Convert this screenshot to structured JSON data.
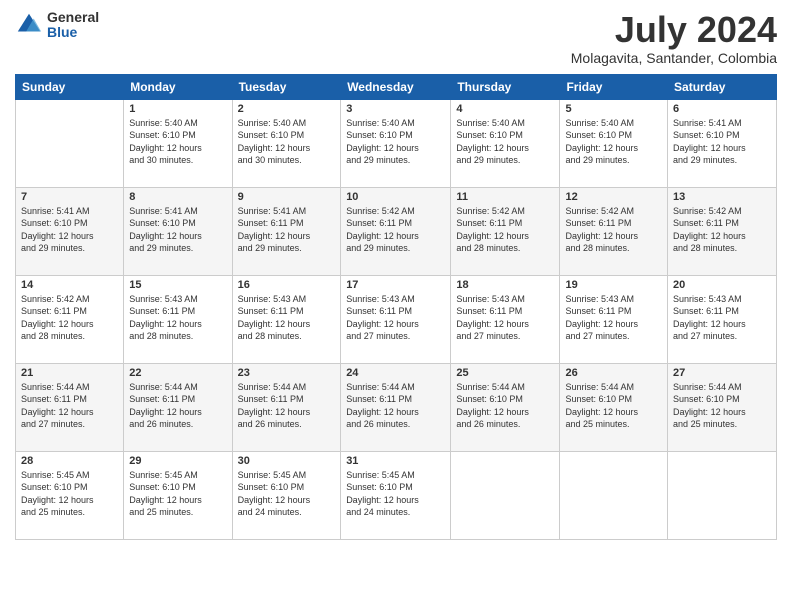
{
  "logo": {
    "general": "General",
    "blue": "Blue"
  },
  "title": "July 2024",
  "location": "Molagavita, Santander, Colombia",
  "days_header": [
    "Sunday",
    "Monday",
    "Tuesday",
    "Wednesday",
    "Thursday",
    "Friday",
    "Saturday"
  ],
  "weeks": [
    [
      {
        "num": "",
        "info": ""
      },
      {
        "num": "1",
        "info": "Sunrise: 5:40 AM\nSunset: 6:10 PM\nDaylight: 12 hours\nand 30 minutes."
      },
      {
        "num": "2",
        "info": "Sunrise: 5:40 AM\nSunset: 6:10 PM\nDaylight: 12 hours\nand 30 minutes."
      },
      {
        "num": "3",
        "info": "Sunrise: 5:40 AM\nSunset: 6:10 PM\nDaylight: 12 hours\nand 29 minutes."
      },
      {
        "num": "4",
        "info": "Sunrise: 5:40 AM\nSunset: 6:10 PM\nDaylight: 12 hours\nand 29 minutes."
      },
      {
        "num": "5",
        "info": "Sunrise: 5:40 AM\nSunset: 6:10 PM\nDaylight: 12 hours\nand 29 minutes."
      },
      {
        "num": "6",
        "info": "Sunrise: 5:41 AM\nSunset: 6:10 PM\nDaylight: 12 hours\nand 29 minutes."
      }
    ],
    [
      {
        "num": "7",
        "info": "Sunrise: 5:41 AM\nSunset: 6:10 PM\nDaylight: 12 hours\nand 29 minutes."
      },
      {
        "num": "8",
        "info": "Sunrise: 5:41 AM\nSunset: 6:10 PM\nDaylight: 12 hours\nand 29 minutes."
      },
      {
        "num": "9",
        "info": "Sunrise: 5:41 AM\nSunset: 6:11 PM\nDaylight: 12 hours\nand 29 minutes."
      },
      {
        "num": "10",
        "info": "Sunrise: 5:42 AM\nSunset: 6:11 PM\nDaylight: 12 hours\nand 29 minutes."
      },
      {
        "num": "11",
        "info": "Sunrise: 5:42 AM\nSunset: 6:11 PM\nDaylight: 12 hours\nand 28 minutes."
      },
      {
        "num": "12",
        "info": "Sunrise: 5:42 AM\nSunset: 6:11 PM\nDaylight: 12 hours\nand 28 minutes."
      },
      {
        "num": "13",
        "info": "Sunrise: 5:42 AM\nSunset: 6:11 PM\nDaylight: 12 hours\nand 28 minutes."
      }
    ],
    [
      {
        "num": "14",
        "info": "Sunrise: 5:42 AM\nSunset: 6:11 PM\nDaylight: 12 hours\nand 28 minutes."
      },
      {
        "num": "15",
        "info": "Sunrise: 5:43 AM\nSunset: 6:11 PM\nDaylight: 12 hours\nand 28 minutes."
      },
      {
        "num": "16",
        "info": "Sunrise: 5:43 AM\nSunset: 6:11 PM\nDaylight: 12 hours\nand 28 minutes."
      },
      {
        "num": "17",
        "info": "Sunrise: 5:43 AM\nSunset: 6:11 PM\nDaylight: 12 hours\nand 27 minutes."
      },
      {
        "num": "18",
        "info": "Sunrise: 5:43 AM\nSunset: 6:11 PM\nDaylight: 12 hours\nand 27 minutes."
      },
      {
        "num": "19",
        "info": "Sunrise: 5:43 AM\nSunset: 6:11 PM\nDaylight: 12 hours\nand 27 minutes."
      },
      {
        "num": "20",
        "info": "Sunrise: 5:43 AM\nSunset: 6:11 PM\nDaylight: 12 hours\nand 27 minutes."
      }
    ],
    [
      {
        "num": "21",
        "info": "Sunrise: 5:44 AM\nSunset: 6:11 PM\nDaylight: 12 hours\nand 27 minutes."
      },
      {
        "num": "22",
        "info": "Sunrise: 5:44 AM\nSunset: 6:11 PM\nDaylight: 12 hours\nand 26 minutes."
      },
      {
        "num": "23",
        "info": "Sunrise: 5:44 AM\nSunset: 6:11 PM\nDaylight: 12 hours\nand 26 minutes."
      },
      {
        "num": "24",
        "info": "Sunrise: 5:44 AM\nSunset: 6:11 PM\nDaylight: 12 hours\nand 26 minutes."
      },
      {
        "num": "25",
        "info": "Sunrise: 5:44 AM\nSunset: 6:10 PM\nDaylight: 12 hours\nand 26 minutes."
      },
      {
        "num": "26",
        "info": "Sunrise: 5:44 AM\nSunset: 6:10 PM\nDaylight: 12 hours\nand 25 minutes."
      },
      {
        "num": "27",
        "info": "Sunrise: 5:44 AM\nSunset: 6:10 PM\nDaylight: 12 hours\nand 25 minutes."
      }
    ],
    [
      {
        "num": "28",
        "info": "Sunrise: 5:45 AM\nSunset: 6:10 PM\nDaylight: 12 hours\nand 25 minutes."
      },
      {
        "num": "29",
        "info": "Sunrise: 5:45 AM\nSunset: 6:10 PM\nDaylight: 12 hours\nand 25 minutes."
      },
      {
        "num": "30",
        "info": "Sunrise: 5:45 AM\nSunset: 6:10 PM\nDaylight: 12 hours\nand 24 minutes."
      },
      {
        "num": "31",
        "info": "Sunrise: 5:45 AM\nSunset: 6:10 PM\nDaylight: 12 hours\nand 24 minutes."
      },
      {
        "num": "",
        "info": ""
      },
      {
        "num": "",
        "info": ""
      },
      {
        "num": "",
        "info": ""
      }
    ]
  ]
}
